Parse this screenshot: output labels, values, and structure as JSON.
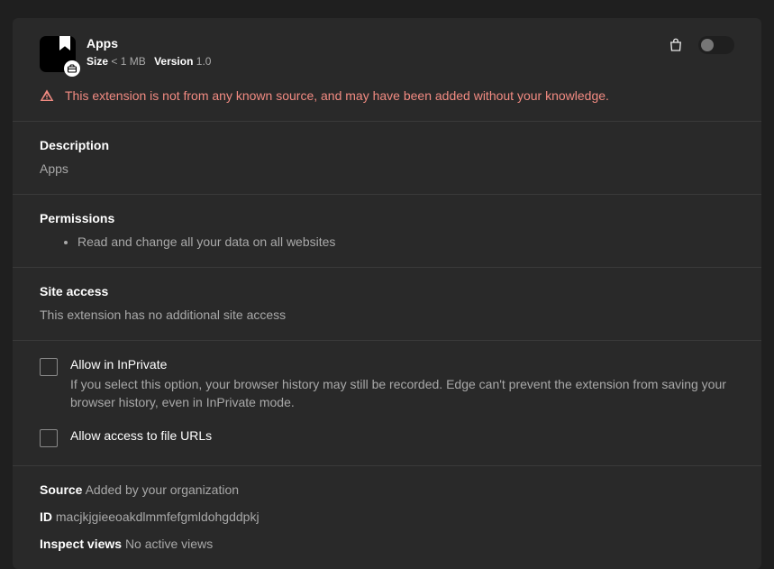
{
  "header": {
    "title": "Apps",
    "size_label": "Size",
    "size_value": "< 1 MB",
    "version_label": "Version",
    "version_value": "1.0"
  },
  "warning": "This extension is not from any known source, and may have been added without your knowledge.",
  "description": {
    "title": "Description",
    "text": "Apps"
  },
  "permissions": {
    "title": "Permissions",
    "items": [
      "Read and change all your data on all websites"
    ]
  },
  "site_access": {
    "title": "Site access",
    "text": "This extension has no additional site access"
  },
  "options": {
    "inprivate": {
      "label": "Allow in InPrivate",
      "desc": "If you select this option, your browser history may still be recorded. Edge can't prevent the extension from saving your browser history, even in InPrivate mode."
    },
    "file_urls": {
      "label": "Allow access to file URLs"
    }
  },
  "meta": {
    "source_label": "Source",
    "source_value": "Added by your organization",
    "id_label": "ID",
    "id_value": "macjkjgieeoakdlmmfefgmldohgddpkj",
    "inspect_label": "Inspect views",
    "inspect_value": "No active views"
  }
}
